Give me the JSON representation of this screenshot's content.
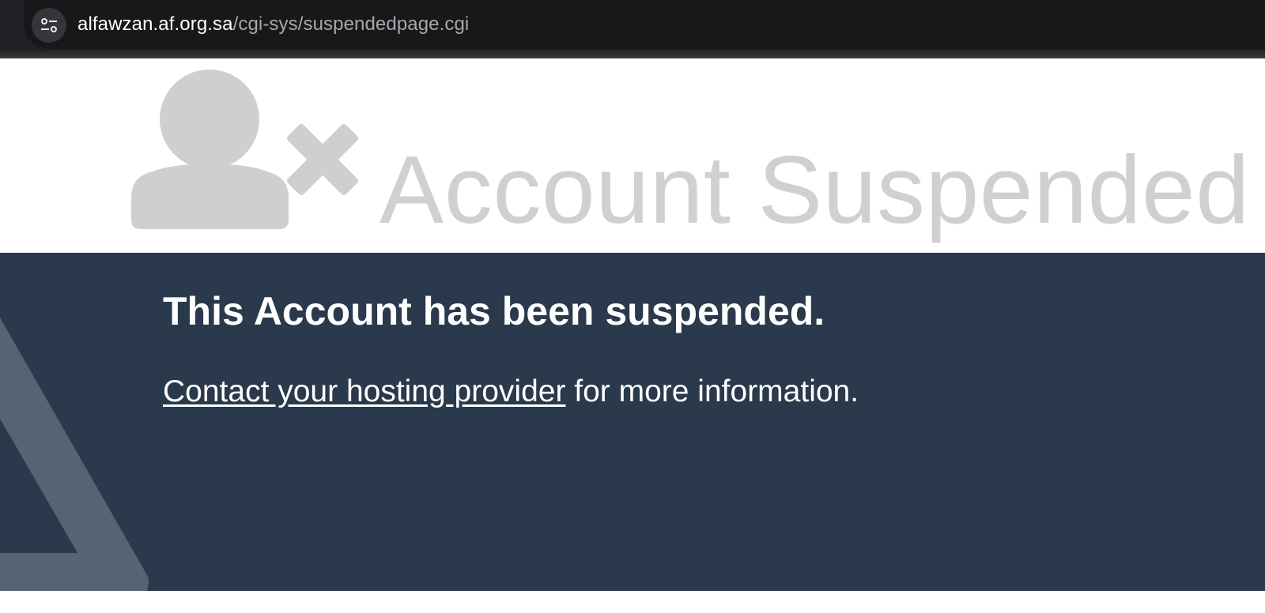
{
  "browser": {
    "url_host": "alfawzan.af.org.sa",
    "url_path": "/cgi-sys/suspendedpage.cgi",
    "site_info_icon": "tune-icon"
  },
  "header": {
    "icon": "user-x-icon",
    "title": "Account Suspended"
  },
  "content": {
    "headline": "This Account has been suspended.",
    "contact_link": "Contact your hosting provider",
    "contact_suffix": " for more information."
  },
  "colors": {
    "browser_bar": "#202124",
    "title_gray": "#d0d0d0",
    "band_navy": "#2a394b",
    "triangle": "#556474"
  }
}
